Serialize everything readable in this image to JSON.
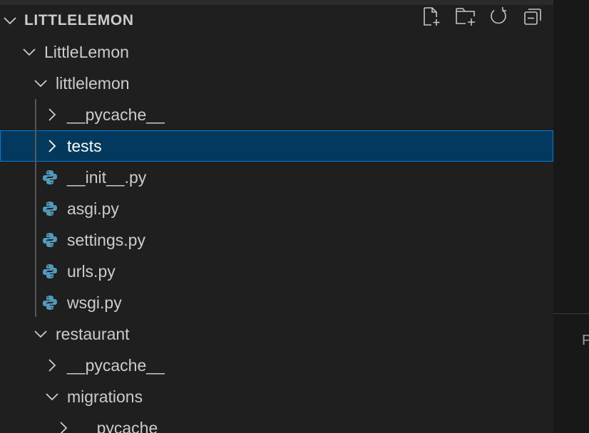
{
  "explorer": {
    "section_title": "LITTLELEMON",
    "actions": [
      {
        "name": "new-file-button",
        "icon": "new-file-icon"
      },
      {
        "name": "new-folder-button",
        "icon": "new-folder-icon"
      },
      {
        "name": "refresh-button",
        "icon": "refresh-icon"
      },
      {
        "name": "collapse-all-button",
        "icon": "collapse-all-icon"
      }
    ],
    "tree": [
      {
        "label": "LittleLemon",
        "type": "folder",
        "expanded": true,
        "depth": 0
      },
      {
        "label": "littlelemon",
        "type": "folder",
        "expanded": true,
        "depth": 1
      },
      {
        "label": "__pycache__",
        "type": "folder",
        "expanded": false,
        "depth": 2
      },
      {
        "label": "tests",
        "type": "folder",
        "expanded": false,
        "depth": 2,
        "selected": true
      },
      {
        "label": "__init__.py",
        "type": "python-file",
        "depth": 2
      },
      {
        "label": "asgi.py",
        "type": "python-file",
        "depth": 2
      },
      {
        "label": "settings.py",
        "type": "python-file",
        "depth": 2
      },
      {
        "label": "urls.py",
        "type": "python-file",
        "depth": 2
      },
      {
        "label": "wsgi.py",
        "type": "python-file",
        "depth": 2
      },
      {
        "label": "restaurant",
        "type": "folder",
        "expanded": true,
        "depth": 1
      },
      {
        "label": "__pycache__",
        "type": "folder",
        "expanded": false,
        "depth": 2
      },
      {
        "label": "migrations",
        "type": "folder",
        "expanded": true,
        "depth": 2
      },
      {
        "label": "__pycache__",
        "type": "folder",
        "expanded": false,
        "depth": 3
      }
    ]
  },
  "right_panel": {
    "letter": "P"
  },
  "colors": {
    "sidebar_bg": "#1f1f1f",
    "selection_bg": "#04395e",
    "selection_border": "#0078d4",
    "text": "#cccccc",
    "python_icon": "#519aba"
  }
}
